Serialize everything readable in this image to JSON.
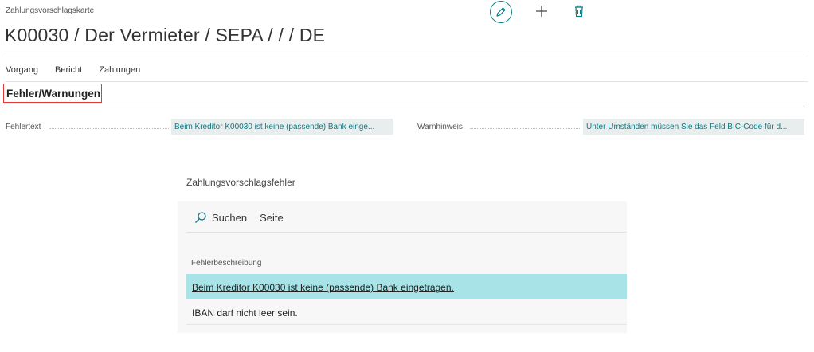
{
  "header": {
    "caption": "Zahlungsvorschlagskarte",
    "title": "K00030 / Der Vermieter / SEPA / / / DE"
  },
  "action_bar": {
    "items": [
      "Vorgang",
      "Bericht",
      "Zahlungen"
    ]
  },
  "section": {
    "title": "Fehler/Warnungen",
    "error_field": {
      "label": "Fehlertext",
      "value": "Beim Kreditor K00030 ist keine (passende) Bank einge..."
    },
    "warning_field": {
      "label": "Warnhinweis",
      "value": "Unter Umständen müssen Sie das Feld BIC-Code für d..."
    }
  },
  "subpage": {
    "title": "Zahlungsvorschlagsfehler",
    "toolbar": {
      "search_label": "Suchen",
      "page_label": "Seite"
    },
    "column_header": "Fehlerbeschreibung",
    "rows": [
      "Beim Kreditor K00030 ist keine (passende) Bank eingetragen.",
      "IBAN darf nicht leer sein."
    ]
  },
  "colors": {
    "accent": "#0a7c86",
    "selected_row": "#a7e3e7",
    "highlight_border": "#e53935"
  },
  "icons": {
    "edit": "pencil-icon",
    "new": "plus-icon",
    "delete": "trash-icon",
    "search": "search-icon"
  }
}
